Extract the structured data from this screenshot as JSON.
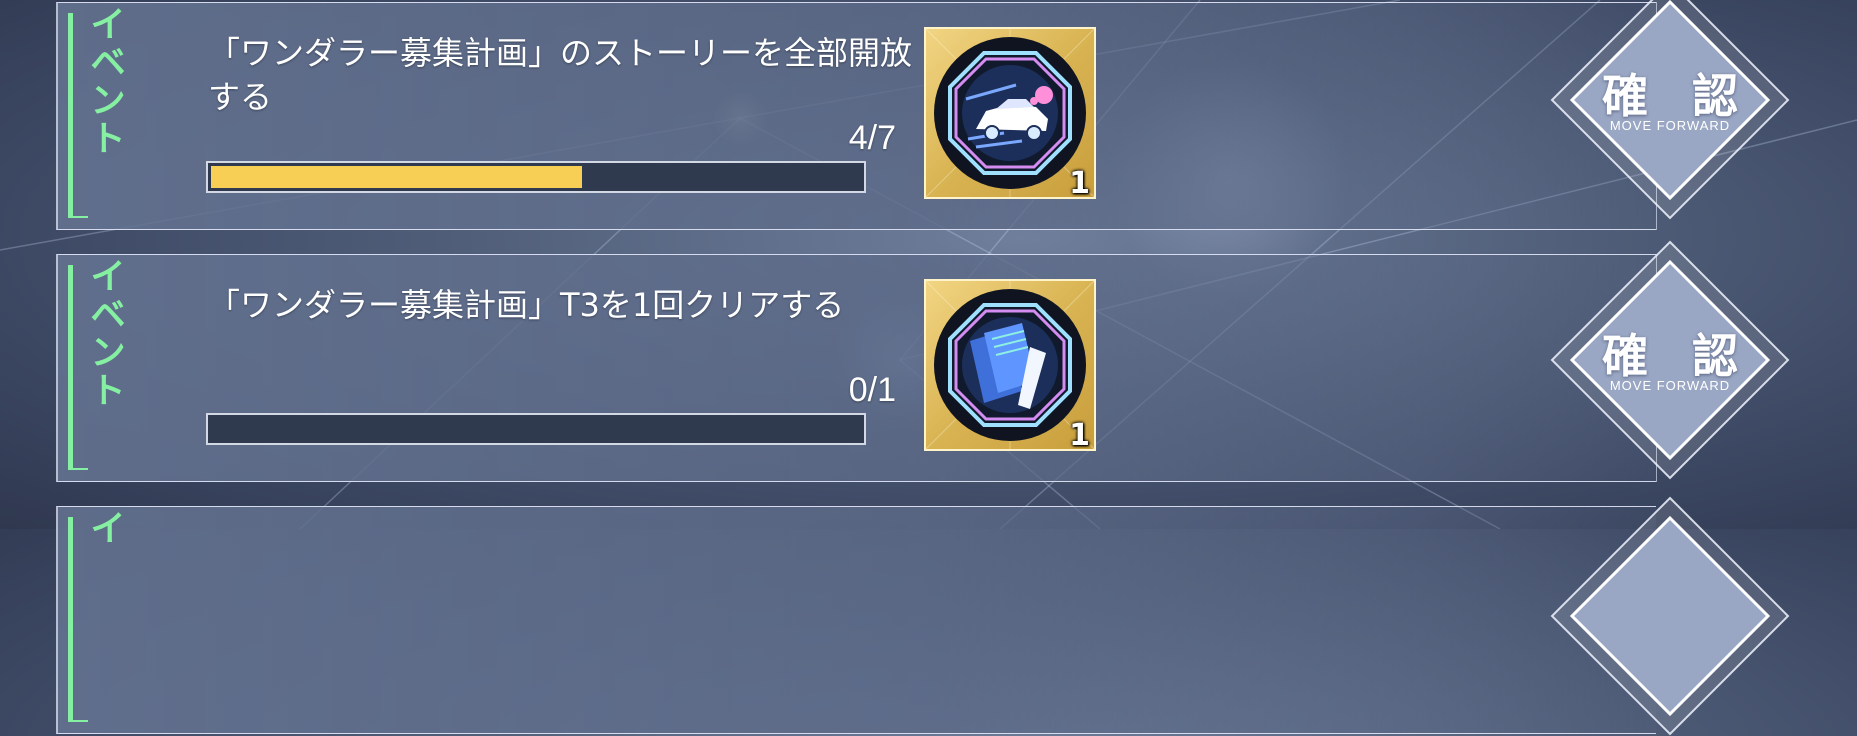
{
  "missions": [
    {
      "category": "イベント",
      "title": "「ワンダラー募集計画」のストーリーを全部開放する",
      "progress_text": "4/7",
      "progress_fraction": 0.571,
      "reward": {
        "icon": "car-emblem-icon",
        "count": "1"
      },
      "button": {
        "label": "確 認",
        "sublabel": "MOVE FORWARD"
      }
    },
    {
      "category": "イベント",
      "title": "「ワンダラー募集計画」T3を1回クリアする",
      "progress_text": "0/1",
      "progress_fraction": 0.0,
      "reward": {
        "icon": "tickets-emblem-icon",
        "count": "1"
      },
      "button": {
        "label": "確 認",
        "sublabel": "MOVE FORWARD"
      }
    },
    {
      "category": "イ"
    }
  ],
  "colors": {
    "category": "#86f0a2",
    "progress_fill": "#f7cf55",
    "progress_track": "#2f3a4e",
    "reward_frame": "#d9b453"
  }
}
